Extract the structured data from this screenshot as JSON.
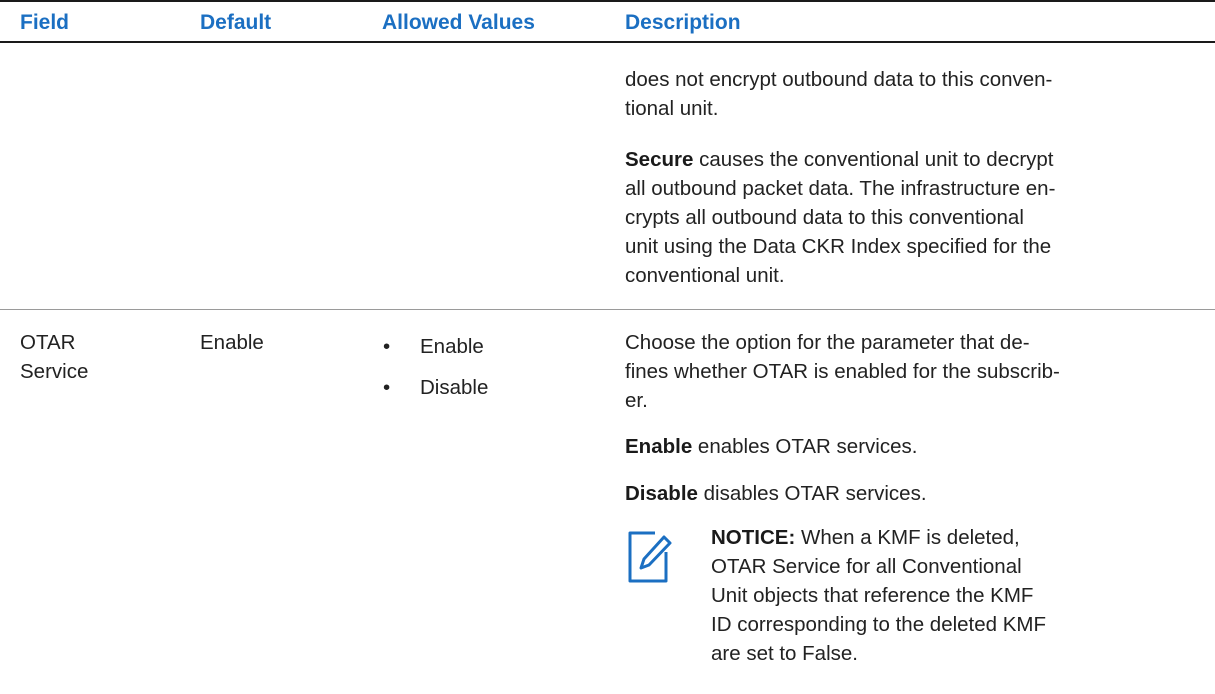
{
  "header": {
    "field": "Field",
    "default": "Default",
    "allowed_values": "Allowed Values",
    "description": "Description"
  },
  "row1": {
    "desc_line1": "does not encrypt outbound data to this conven-",
    "desc_line2": "tional unit.",
    "secure_term": "Secure",
    "secure_line1": " causes the conventional unit to decrypt",
    "secure_line2": "all outbound packet data. The infrastructure en-",
    "secure_line3": "crypts all outbound data to this conventional",
    "secure_line4": "unit using the Data CKR Index specified for the",
    "secure_line5": "conventional unit."
  },
  "row2": {
    "field_line1": "OTAR",
    "field_line2": "Service",
    "default": "Enable",
    "allowed_values": [
      "Enable",
      "Disable"
    ],
    "bullet": "•",
    "choose_line1": "Choose the option for the parameter that de-",
    "choose_line2": "fines whether OTAR is enabled for the subscrib-",
    "choose_line3": "er.",
    "enable_term": "Enable",
    "enable_desc": " enables OTAR services.",
    "disable_term": "Disable",
    "disable_desc": " disables OTAR services.",
    "notice": {
      "label": "NOTICE:",
      "line1": " When a KMF is deleted,",
      "line2": "OTAR Service for all Conventional",
      "line3": "Unit objects that reference the KMF",
      "line4": "ID corresponding to the deleted KMF",
      "line5": "are set to False.",
      "icon": "notice-pencil-icon"
    }
  },
  "colors": {
    "header_text": "#1b6fc2",
    "notice_icon": "#1b6fc2",
    "divider": "#9a9a9a",
    "rule": "#1a1a1a"
  }
}
